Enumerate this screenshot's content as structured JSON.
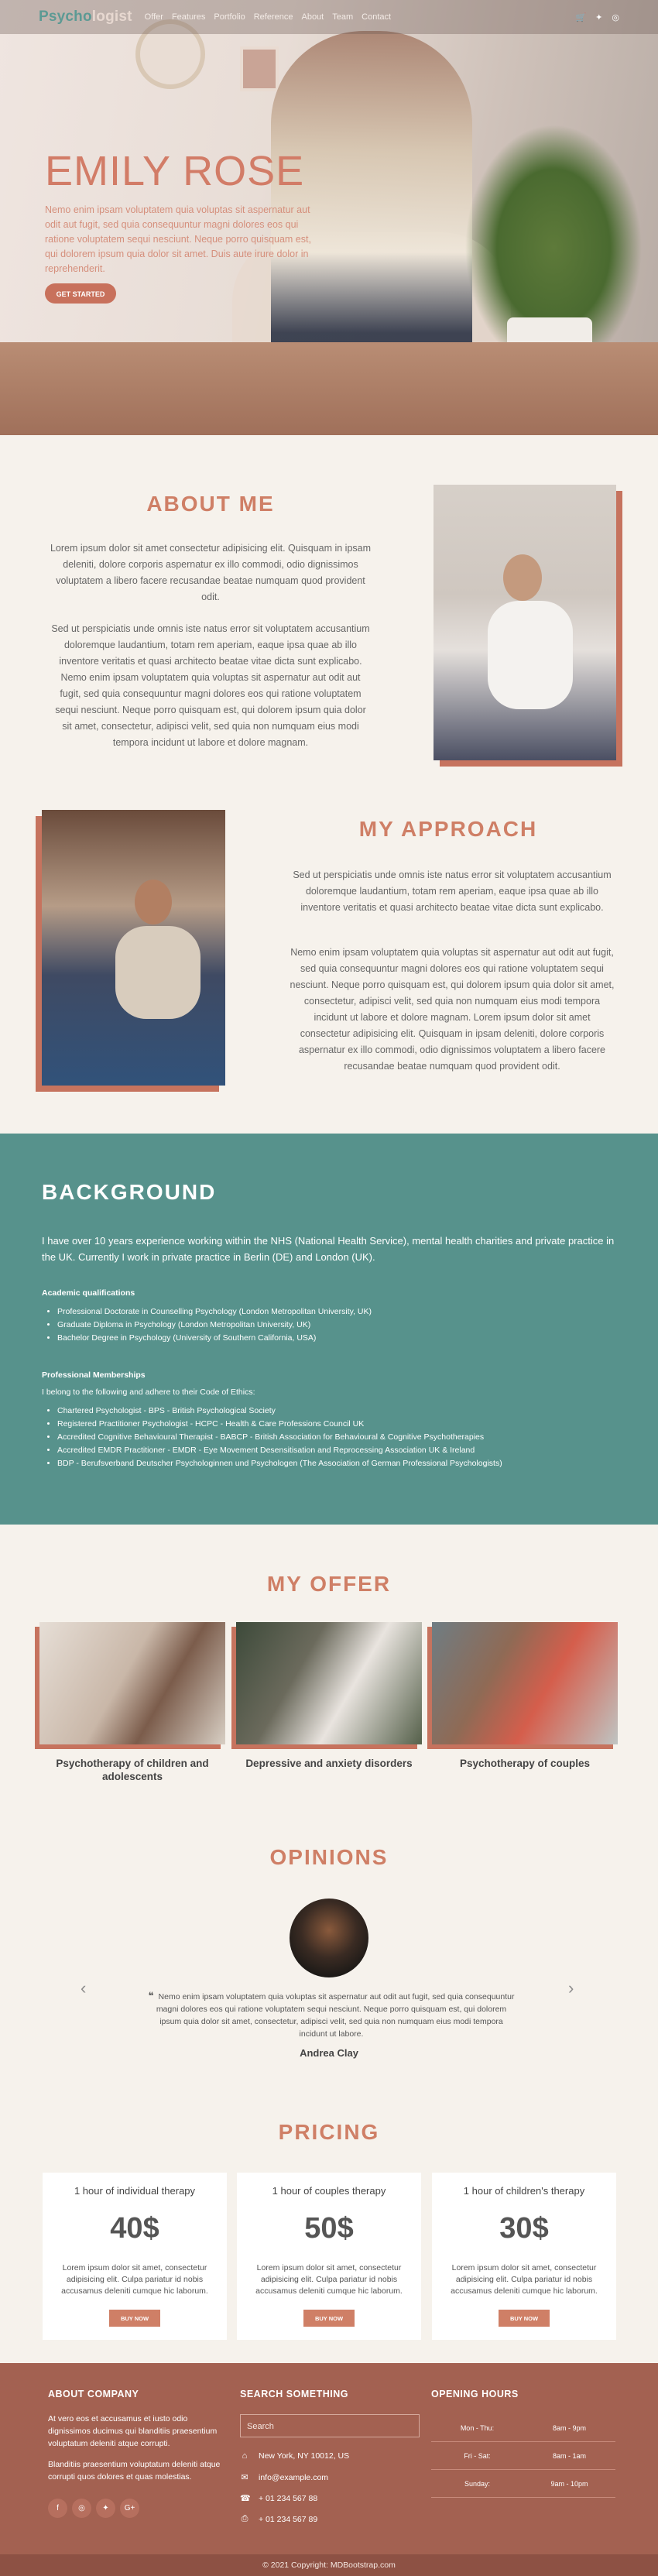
{
  "nav": {
    "brand_part1": "Psycho",
    "brand_part2": "logist",
    "links": [
      "Offer",
      "Features",
      "Portfolio",
      "Reference",
      "About",
      "Team",
      "Contact"
    ]
  },
  "hero": {
    "title": "EMILY ROSE",
    "lead": "Nemo enim ipsam voluptatem quia voluptas sit aspernatur aut odit aut fugit, sed quia consequuntur magni dolores eos qui ratione voluptatem sequi nesciunt. Neque porro quisquam est, qui dolorem ipsum quia dolor sit amet. Duis aute irure dolor in reprehenderit.",
    "cta": "GET STARTED"
  },
  "about": {
    "title": "ABOUT ME",
    "p1": "Lorem ipsum dolor sit amet consectetur adipisicing elit. Quisquam in ipsam deleniti, dolore corporis aspernatur ex illo commodi, odio dignissimos voluptatem a libero facere recusandae beatae numquam quod provident odit.",
    "p2": "Sed ut perspiciatis unde omnis iste natus error sit voluptatem accusantium doloremque laudantium, totam rem aperiam, eaque ipsa quae ab illo inventore veritatis et quasi architecto beatae vitae dicta sunt explicabo. Nemo enim ipsam voluptatem quia voluptas sit aspernatur aut odit aut fugit, sed quia consequuntur magni dolores eos qui ratione voluptatem sequi nesciunt. Neque porro quisquam est, qui dolorem ipsum quia dolor sit amet, consectetur, adipisci velit, sed quia non numquam eius modi tempora incidunt ut labore et dolore magnam."
  },
  "approach": {
    "title": "MY APPROACH",
    "p1": "Sed ut perspiciatis unde omnis iste natus error sit voluptatem accusantium doloremque laudantium, totam rem aperiam, eaque ipsa quae ab illo inventore veritatis et quasi architecto beatae vitae dicta sunt explicabo.",
    "p2": "Nemo enim ipsam voluptatem quia voluptas sit aspernatur aut odit aut fugit, sed quia consequuntur magni dolores eos qui ratione voluptatem sequi nesciunt. Neque porro quisquam est, qui dolorem ipsum quia dolor sit amet, consectetur, adipisci velit, sed quia non numquam eius modi tempora incidunt ut labore et dolore magnam. Lorem ipsum dolor sit amet consectetur adipisicing elit. Quisquam in ipsam deleniti, dolore corporis aspernatur ex illo commodi, odio dignissimos voluptatem a libero facere recusandae beatae numquam quod provident odit."
  },
  "background": {
    "title": "BACKGROUND",
    "intro": "I have over 10 years experience working within the NHS (National Health Service), mental health charities and private practice in the UK. Currently I work in private practice in Berlin (DE) and London (UK).",
    "academic_heading": "Academic qualifications",
    "academic": [
      "Professional Doctorate in Counselling Psychology (London Metropolitan University, UK)",
      "Graduate Diploma in Psychology (London Metropolitan University, UK)",
      "Bachelor Degree in Psychology (University of Southern California, USA)"
    ],
    "memberships_heading": "Professional Memberships",
    "memberships_intro": "I belong to the following and adhere to their Code of Ethics:",
    "memberships": [
      "Chartered Psychologist - BPS - British Psychological Society",
      "Registered Practitioner Psychologist - HCPC - Health & Care Professions Council UK",
      "Accredited Cognitive Behavioural Therapist - BABCP - British Association for Behavioural & Cognitive Psychotherapies",
      "Accredited EMDR Practitioner - EMDR - Eye Movement Desensitisation and Reprocessing Association UK & Ireland",
      "BDP - Berufsverband Deutscher Psychologinnen und Psychologen (The Association of German Professional Psychologists)"
    ]
  },
  "offer": {
    "title": "MY OFFER",
    "items": [
      {
        "caption": "Psychotherapy of children and adolescents"
      },
      {
        "caption": "Depressive and anxiety disorders"
      },
      {
        "caption": "Psychotherapy of couples"
      }
    ]
  },
  "opinions": {
    "title": "OPINIONS",
    "quote_mark": "❝",
    "quote": "Nemo enim ipsam voluptatem quia voluptas sit aspernatur aut odit aut fugit, sed quia consequuntur magni dolores eos qui ratione voluptatem sequi nesciunt. Neque porro quisquam est, qui dolorem ipsum quia dolor sit amet, consectetur, adipisci velit, sed quia non numquam eius modi tempora incidunt ut labore.",
    "author": "Andrea Clay",
    "prev": "‹",
    "next": "›"
  },
  "pricing": {
    "title": "PRICING",
    "plans": [
      {
        "name": "1 hour of individual therapy",
        "price": "40$",
        "desc": "Lorem ipsum dolor sit amet, consectetur adipisicing elit. Culpa pariatur id nobis accusamus deleniti cumque hic laborum.",
        "button": "BUY NOW"
      },
      {
        "name": "1 hour of couples therapy",
        "price": "50$",
        "desc": "Lorem ipsum dolor sit amet, consectetur adipisicing elit. Culpa pariatur id nobis accusamus deleniti cumque hic laborum.",
        "button": "BUY NOW"
      },
      {
        "name": "1 hour of children's therapy",
        "price": "30$",
        "desc": "Lorem ipsum dolor sit amet, consectetur adipisicing elit. Culpa pariatur id nobis accusamus deleniti cumque hic laborum.",
        "button": "BUY NOW"
      }
    ]
  },
  "footer": {
    "about_title": "ABOUT COMPANY",
    "about_p1": "At vero eos et accusamus et iusto odio dignissimos ducimus qui blanditiis praesentium voluptatum deleniti atque corrupti.",
    "about_p2": "Blanditiis praesentium voluptatum deleniti atque corrupti quos dolores et quas molestias.",
    "socials": [
      "f",
      "◎",
      "✦",
      "G+"
    ],
    "search_title": "SEARCH SOMETHING",
    "search_placeholder": "Search",
    "address": "New York, NY 10012, US",
    "email": "info@example.com",
    "phone1": "+ 01 234 567 88",
    "phone2": "+ 01 234 567 89",
    "hours_title": "OPENING HOURS",
    "hours": [
      {
        "days": "Mon - Thu:",
        "time": "8am - 9pm"
      },
      {
        "days": "Fri - Sat:",
        "time": "8am - 1am"
      },
      {
        "days": "Sunday:",
        "time": "9am - 10pm"
      }
    ]
  },
  "copyright": "© 2021 Copyright: MDBootstrap.com"
}
